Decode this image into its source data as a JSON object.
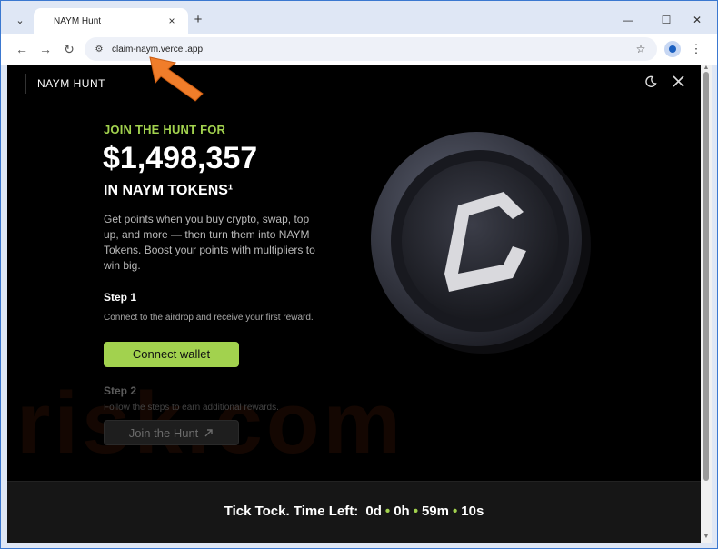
{
  "browser": {
    "tab_title": "NAYM Hunt",
    "tab_close": "×",
    "new_tab": "+",
    "url": "claim-naym.vercel.app",
    "minimize": "—",
    "maximize": "☐",
    "close": "✕"
  },
  "site": {
    "brand": "NAYM HUNT",
    "eyebrow": "JOIN THE HUNT FOR",
    "amount": "$1,498,357",
    "tokens": "IN NAYM TOKENS¹",
    "description": "Get points when you buy crypto, swap, top up, and more — then turn them into NAYM Tokens. Boost your points with multipliers to win big.",
    "step1_title": "Step 1",
    "step1_text": "Connect to the airdrop and receive your first reward.",
    "connect_label": "Connect wallet",
    "step2_title": "Step 2",
    "step2_text": "Follow the steps to earn additional rewards.",
    "hunt_label": "Join the Hunt",
    "timer_label": "Tick Tock. Time Left:",
    "timer_days": "0d",
    "timer_hours": "0h",
    "timer_minutes": "59m",
    "timer_seconds": "10s",
    "watermark": "risk.com"
  },
  "colors": {
    "accent": "#a2d24e",
    "annotation": "#f07d2a"
  },
  "icons": {
    "theme": "moon-icon",
    "social": "x-icon",
    "arrow": "arrow-up-right-icon"
  }
}
